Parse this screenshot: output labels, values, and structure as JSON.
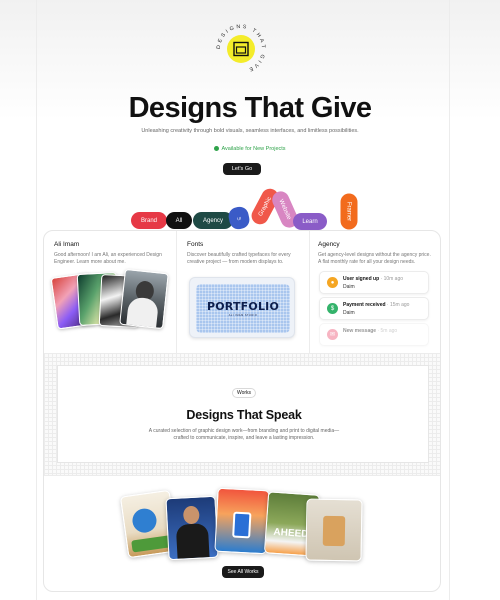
{
  "logo": {
    "ring_text": "DESIGNS THAT GIVE",
    "name": "square-logo-icon"
  },
  "hero": {
    "title": "Designs That Give",
    "subtitle": "Unleashing creativity through bold visuals, seamless interfaces, and limitless possibilities.",
    "availability": "Available for New Projects",
    "cta": "Let's Go"
  },
  "tags": [
    {
      "label": "Brand",
      "color": "#e63946"
    },
    {
      "label": "All",
      "color": "#111111"
    },
    {
      "label": "Agency",
      "color": "#1f4a45"
    },
    {
      "label": "UI",
      "color": "#3a5bc7"
    },
    {
      "label": "Graphic",
      "color": "#f0584a"
    },
    {
      "label": "Website",
      "color": "#d886c2"
    },
    {
      "label": "Learn",
      "color": "#8a5cc7"
    },
    {
      "label": "Framer",
      "color": "#f26b1d"
    }
  ],
  "features": {
    "about": {
      "title": "Ali Imam",
      "text": "Good afternoon! I am Ali, an experienced Design Engineer. Learn more about me."
    },
    "fonts": {
      "title": "Fonts",
      "text": "Discover beautifully crafted typefaces for every creative project — from modern displays to.",
      "sample": "PORTFOLIO",
      "sample_tag": "ALI IMAM STUDIO"
    },
    "agency": {
      "title": "Agency",
      "text": "Get agency-level designs without the agency price. A flat monthly rate for all your design needs.",
      "notifications": [
        {
          "title": "User signed up",
          "time": "· 10m ago",
          "name": "Daim",
          "color": "#f5a623",
          "icon": "user-icon"
        },
        {
          "title": "Payment received",
          "time": "· 15m ago",
          "name": "Daim",
          "color": "#34b36b",
          "icon": "money-icon"
        },
        {
          "title": "New message",
          "time": "· 5m ago",
          "name": "",
          "color": "#ef5a7a",
          "icon": "message-icon"
        }
      ]
    }
  },
  "works": {
    "badge": "Works",
    "title": "Designs That Speak",
    "description": "A curated selection of graphic design work—from branding and print to digital media—crafted to communicate, inspire, and leave a lasting impression.",
    "gallery_text": "AHEEDI",
    "button": "See All Works"
  }
}
